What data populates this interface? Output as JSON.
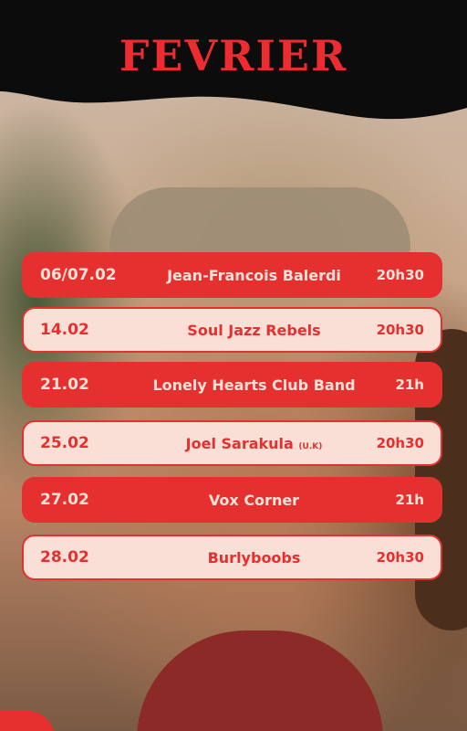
{
  "title": "FEVRIER",
  "events": [
    {
      "date": "06/07.02",
      "artist": "Jean-Francois Balerdi",
      "note": "",
      "time": "20h30",
      "style": "red"
    },
    {
      "date": "14.02",
      "artist": "Soul Jazz Rebels",
      "note": "",
      "time": "20h30",
      "style": "cream"
    },
    {
      "date": "21.02",
      "artist": "Lonely Hearts Club Band",
      "note": "",
      "time": "21h",
      "style": "red"
    },
    {
      "date": "25.02",
      "artist": "Joel Sarakula",
      "note": "(U.K)",
      "time": "20h30",
      "style": "cream"
    },
    {
      "date": "27.02",
      "artist": "Vox Corner",
      "note": "",
      "time": "21h",
      "style": "red"
    },
    {
      "date": "28.02",
      "artist": "Burlyboobs",
      "note": "",
      "time": "20h30",
      "style": "cream"
    }
  ],
  "colors": {
    "accent_red": "#e5302f",
    "cream": "#fadfd7",
    "band_black": "#0c0c0c"
  }
}
